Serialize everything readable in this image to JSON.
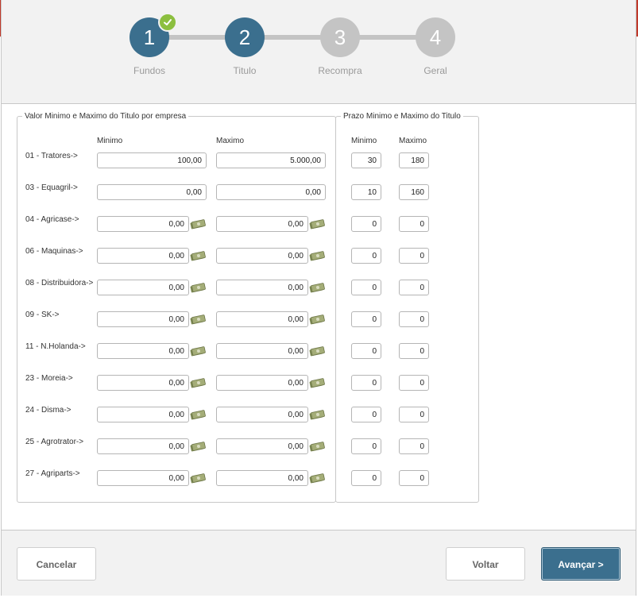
{
  "wizard": {
    "steps": [
      {
        "number": "1",
        "label": "Fundos",
        "state": "done"
      },
      {
        "number": "2",
        "label": "Titulo",
        "state": "active"
      },
      {
        "number": "3",
        "label": "Recompra",
        "state": "inactive"
      },
      {
        "number": "4",
        "label": "Geral",
        "state": "inactive"
      }
    ]
  },
  "valor": {
    "legend": "Valor Minimo e Maximo do Titulo por empresa",
    "col_min": "Minimo",
    "col_max": "Maximo"
  },
  "prazo": {
    "legend": "Prazo Minimo e Maximo do Titulo",
    "col_min": "Minimo",
    "col_max": "Maximo"
  },
  "rows": [
    {
      "label": "01 - Tratores->",
      "min": "100,00",
      "max": "5.000,00",
      "pmin": "30",
      "pmax": "180",
      "icon": false
    },
    {
      "label": "03 - Equagril->",
      "min": "0,00",
      "max": "0,00",
      "pmin": "10",
      "pmax": "160",
      "icon": false
    },
    {
      "label": "04 - Agricase->",
      "min": "0,00",
      "max": "0,00",
      "pmin": "0",
      "pmax": "0",
      "icon": true
    },
    {
      "label": "06 - Maquinas->",
      "min": "0,00",
      "max": "0,00",
      "pmin": "0",
      "pmax": "0",
      "icon": true
    },
    {
      "label": "08 - Distribuidora->",
      "min": "0,00",
      "max": "0,00",
      "pmin": "0",
      "pmax": "0",
      "icon": true
    },
    {
      "label": "09 - SK->",
      "min": "0,00",
      "max": "0,00",
      "pmin": "0",
      "pmax": "0",
      "icon": true
    },
    {
      "label": "11 - N.Holanda->",
      "min": "0,00",
      "max": "0,00",
      "pmin": "0",
      "pmax": "0",
      "icon": true
    },
    {
      "label": "23 - Moreia->",
      "min": "0,00",
      "max": "0,00",
      "pmin": "0",
      "pmax": "0",
      "icon": true
    },
    {
      "label": "24 - Disma->",
      "min": "0,00",
      "max": "0,00",
      "pmin": "0",
      "pmax": "0",
      "icon": true
    },
    {
      "label": "25 - Agrotrator->",
      "min": "0,00",
      "max": "0,00",
      "pmin": "0",
      "pmax": "0",
      "icon": true
    },
    {
      "label": "27 - Agriparts->",
      "min": "0,00",
      "max": "0,00",
      "pmin": "0",
      "pmax": "0",
      "icon": true
    }
  ],
  "footer": {
    "cancel_label": "Cancelar",
    "back_label": "Voltar",
    "next_label": "Avançar >"
  },
  "colors": {
    "active_step": "#3b6f8e",
    "inactive_step": "#c4c4c4",
    "done_check": "#8cbf3f"
  },
  "icons": {
    "done": "check-icon",
    "money": "money-icon"
  }
}
